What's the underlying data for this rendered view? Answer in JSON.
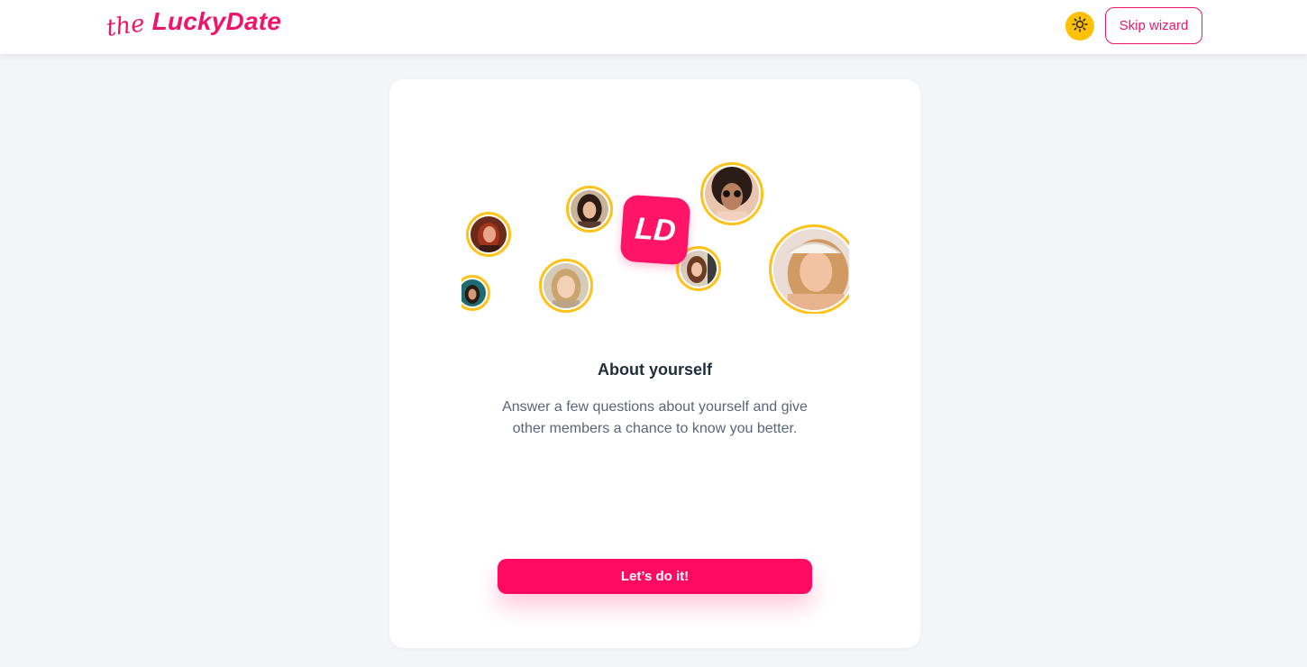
{
  "header": {
    "logo_prefix": "the",
    "logo_name": "LuckyDate",
    "skip_label": "Skip wizard"
  },
  "illustration": {
    "badge_text": "LD"
  },
  "main": {
    "title": "About yourself",
    "description": "Answer a few questions about yourself and give other members a chance to know you better.",
    "cta_label": "Let’s do it!"
  },
  "colors": {
    "brand": "#f0156b",
    "cta": "#ff0a62",
    "accent_yellow": "#ffc107",
    "background": "#f4f5f9"
  },
  "icons": {
    "theme_toggle": "sun-icon"
  }
}
